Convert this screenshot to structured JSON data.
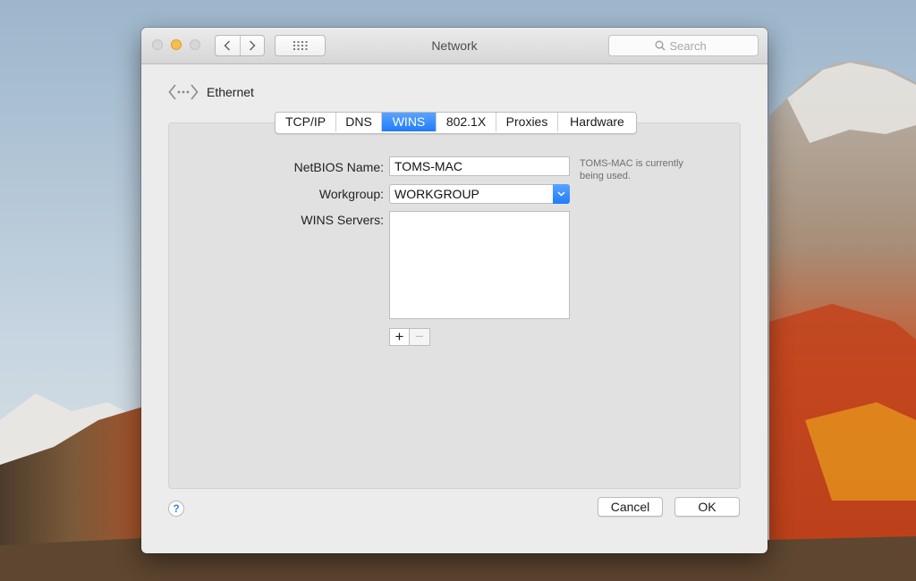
{
  "window": {
    "title": "Network"
  },
  "toolbar": {
    "back_icon": "chevron-left-icon",
    "forward_icon": "chevron-right-icon",
    "grid_icon": "grid-icon",
    "search": {
      "placeholder": "Search",
      "icon": "search-icon"
    }
  },
  "header": {
    "interface_label": "Ethernet",
    "icon": "ethernet-icon"
  },
  "tabs": [
    {
      "label": "TCP/IP",
      "active": false
    },
    {
      "label": "DNS",
      "active": false
    },
    {
      "label": "WINS",
      "active": true
    },
    {
      "label": "802.1X",
      "active": false
    },
    {
      "label": "Proxies",
      "active": false
    },
    {
      "label": "Hardware",
      "active": false
    }
  ],
  "wins": {
    "netbios_label": "NetBIOS Name:",
    "netbios_value": "TOMS-MAC",
    "note": [
      "TOMS-MAC is currently",
      "being used."
    ],
    "workgroup_label": "Workgroup:",
    "workgroup_value": "WORKGROUP",
    "servers_label": "WINS Servers:",
    "add_label": "+",
    "remove_label": "−"
  },
  "footer": {
    "help_label": "?",
    "cancel_label": "Cancel",
    "ok_label": "OK"
  },
  "colors": {
    "accent": "#2a82fb",
    "traffic_min": "#f5be4f"
  }
}
